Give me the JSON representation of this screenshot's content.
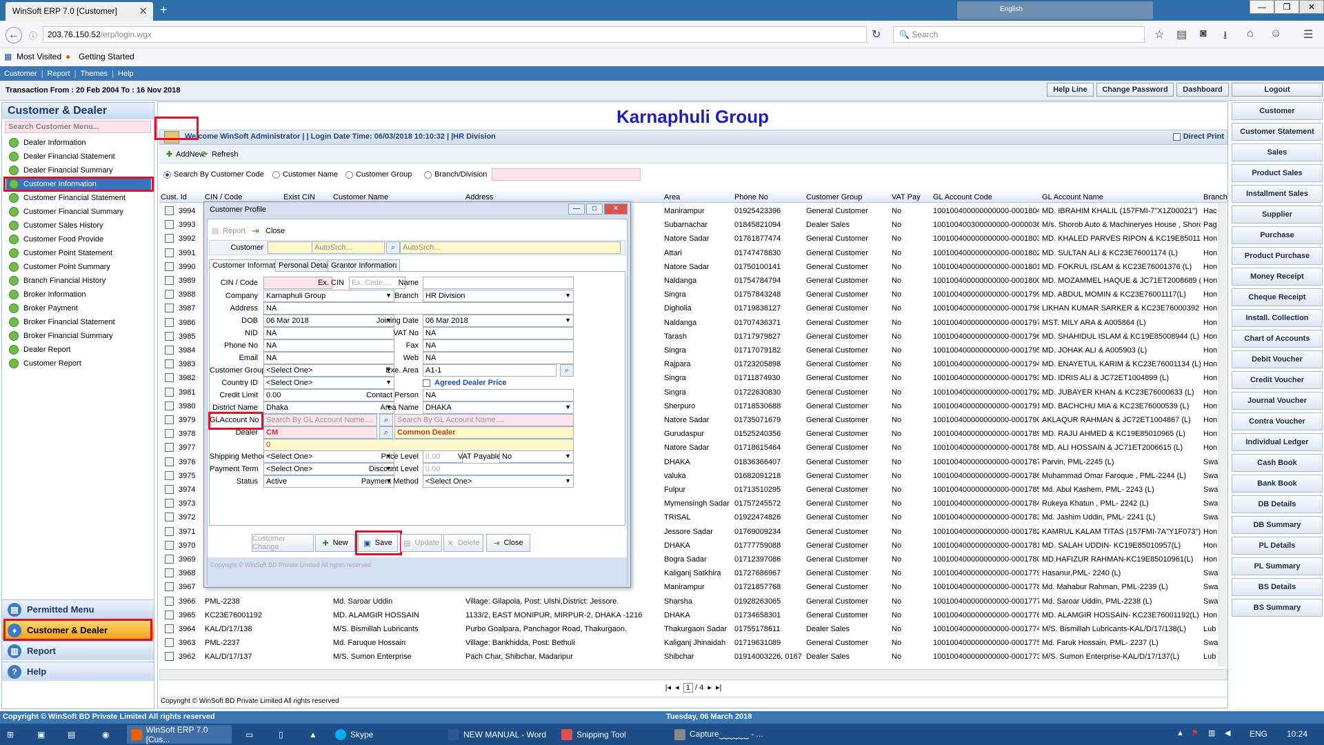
{
  "browser": {
    "tab_title": "WinSoft ERP 7.0 [Customer]",
    "url_host": "203.76.150.52",
    "url_path": "/erp/login.wgx",
    "search_placeholder": "Search",
    "bookmarks": [
      "Most Visited",
      "Getting Started"
    ],
    "lang": "English"
  },
  "app_menu": [
    "Customer",
    "Report",
    "Themes",
    "Help"
  ],
  "transaction": "Transaction From : 20 Feb 2004 To : 16 Nov 2018",
  "top_buttons": [
    "Help Line",
    "Change Password",
    "Dashboard",
    "Logout"
  ],
  "left": {
    "title": "Customer & Dealer",
    "search_placeholder": "Search Customer Menu...",
    "items": [
      "Dealer Information",
      "Dealer Financial Statement",
      "Dealer Financial Summary",
      "Customer Information",
      "Customer Financial Statement",
      "Customer Financial Summary",
      "Customer Sales History",
      "Customer Food Provide",
      "Customer Point Statement",
      "Customer Point Summary",
      "Branch Financial History",
      "Broker Information",
      "Broker Payment",
      "Broker Financial Statement",
      "Broker Financial Summary",
      "Dealer Report",
      "Customer Report"
    ],
    "sections": [
      "Permitted Menu",
      "Customer & Dealer",
      "Report",
      "Help"
    ]
  },
  "right_buttons": [
    "Customer",
    "Customer Statement",
    "Sales",
    "Product Sales",
    "Installment Sales",
    "Supplier",
    "Purchase",
    "Product Purchase",
    "Money Receipt",
    "Cheque Receipt",
    "Install. Collection",
    "Chart of Accounts",
    "Debit Voucher",
    "Credit Voucher",
    "Journal Voucher",
    "Contra Voucher",
    "Individual Ledger",
    "Cash Book",
    "Bank Book",
    "DB Details",
    "DB Summary",
    "PL Details",
    "PL Summary",
    "BS Details",
    "BS Summary"
  ],
  "main": {
    "title": "Karnaphuli Group",
    "welcome": "Welcome WinSoft Administrator | | Login Date  Time: 06/03/2018 10:10:32 | |HR Division",
    "direct_print": "Direct Print",
    "addnew": "AddNew",
    "refresh": "Refresh",
    "search_opts": [
      "Search By Customer Code",
      "Customer Name",
      "Customer Group",
      "Branch/Division"
    ],
    "columns": [
      "Cust. Id",
      "CIN / Code",
      "Exist CIN",
      "Customer Name",
      "Address",
      "Area",
      "Phone No",
      "Customer Group",
      "VAT Pay",
      "GL Account Code",
      "GL Account Name",
      "Branch N"
    ],
    "pager": {
      "current": "1",
      "total": "/ 4"
    },
    "copyright": "Copyright © WinSoft BD Private Limited All rights reserved"
  },
  "rows": [
    {
      "id": "3994",
      "cin": "",
      "name": "",
      "addr": "...,P/S: M",
      "area": "Manirampur",
      "phone": "01925423396",
      "group": "General Customer",
      "vat": "No",
      "gl": "100100400000000000-0001804",
      "gln": "MD. IBRAHIM KHALIL (157FMI-7\"X1Z00021\")",
      "br": "Hac"
    },
    {
      "id": "3993",
      "cin": "",
      "name": "",
      "addr": "Nar",
      "area": "Subarnachar",
      "phone": "01845821094",
      "group": "Dealer Sales",
      "vat": "No",
      "gl": "100100400300000000-0000036",
      "gln": "M/s. Shorob Auto & Machineryes House , Shorob",
      "br": "Pag"
    },
    {
      "id": "3992",
      "cin": "",
      "name": "",
      "addr": "",
      "area": "Natore Sadar",
      "phone": "01761877474",
      "group": "General Customer",
      "vat": "No",
      "gl": "100100400000000000-0001803",
      "gln": "MD. KHALED PARVES RIPON & KC19E85011066",
      "br": "Hon"
    },
    {
      "id": "3991",
      "cin": "",
      "name": "",
      "addr": "",
      "area": "Attari",
      "phone": "01747478830",
      "group": "General Customer",
      "vat": "No",
      "gl": "100100400000000000-0001802",
      "gln": "MD. SULTAN ALI & KC23E76001174 (L)",
      "br": "Hon"
    },
    {
      "id": "3990",
      "cin": "",
      "name": "",
      "addr": "",
      "area": "Natore Sadar",
      "phone": "01750100141",
      "group": "General Customer",
      "vat": "No",
      "gl": "100100400000000000-0001801",
      "gln": "MD. FOKRUL ISLAM & KC23E76001376 (L)",
      "br": "Hon"
    },
    {
      "id": "3989",
      "cin": "",
      "name": "",
      "addr": "",
      "area": "Naldanga",
      "phone": "01754784794",
      "group": "General Customer",
      "vat": "No",
      "gl": "100100400000000000-0001800",
      "gln": "MD. MOZAMMEL HAQUE & JC71ET2008689 (L)",
      "br": "Hon"
    },
    {
      "id": "3988",
      "cin": "",
      "name": "",
      "addr": "",
      "area": "Singra",
      "phone": "01757843248",
      "group": "General Customer",
      "vat": "No",
      "gl": "100100400000000000-0001799",
      "gln": "MD. ABDUL MOMIN & KC23E76001117(L)",
      "br": "Hon"
    },
    {
      "id": "3987",
      "cin": "",
      "name": "",
      "addr": "",
      "area": "Digholia",
      "phone": "01719838127",
      "group": "General Customer",
      "vat": "No",
      "gl": "100100400000000000-0001798",
      "gln": "LIKHAN KUMAR SARKER & KC23E76000392 (L)",
      "br": "Hon"
    },
    {
      "id": "3986",
      "cin": "",
      "name": "",
      "addr": "",
      "area": "Naldanga",
      "phone": "01707436371",
      "group": "General Customer",
      "vat": "No",
      "gl": "100100400000000000-0001797",
      "gln": "MST. MILY ARA & A005864 (L)",
      "br": "Hon"
    },
    {
      "id": "3985",
      "cin": "",
      "name": "",
      "addr": "",
      "area": "Tarash",
      "phone": "01717979827",
      "group": "General Customer",
      "vat": "No",
      "gl": "100100400000000000-0001796",
      "gln": "MD. SHAHIDUL ISLAM & KC19E85008944 (L)",
      "br": "Hon"
    },
    {
      "id": "3984",
      "cin": "",
      "name": "",
      "addr": "",
      "area": "Singra",
      "phone": "01717079182",
      "group": "General Customer",
      "vat": "No",
      "gl": "100100400000000000-0001795",
      "gln": "MD. JOHAK ALI & A005903 (L)",
      "br": "Hon"
    },
    {
      "id": "3983",
      "cin": "",
      "name": "",
      "addr": "",
      "area": "Rajpara",
      "phone": "01723205898",
      "group": "General Customer",
      "vat": "No",
      "gl": "100100400000000000-0001794",
      "gln": "MD. ENAYETUL KARIM & KC23E76001134 (L)",
      "br": "Hon"
    },
    {
      "id": "3982",
      "cin": "",
      "name": "",
      "addr": "",
      "area": "Singra",
      "phone": "01711874930",
      "group": "General Customer",
      "vat": "No",
      "gl": "100100400000000000-0001793",
      "gln": "MD. IDRIS ALI & JC72ET1004899 (L)",
      "br": "Hon"
    },
    {
      "id": "3981",
      "cin": "",
      "name": "",
      "addr": "",
      "area": "Singra",
      "phone": "01722630830",
      "group": "General Customer",
      "vat": "No",
      "gl": "100100400000000000-0001792",
      "gln": "MD. JUBAYER KHAN & KC23E76000633 (L)",
      "br": "Hon"
    },
    {
      "id": "3980",
      "cin": "",
      "name": "",
      "addr": "",
      "area": "Sherpuro",
      "phone": "01718530688",
      "group": "General Customer",
      "vat": "No",
      "gl": "100100400000000000-0001791",
      "gln": "MD. BACHCHU MIA & KC23E76000539 (L)",
      "br": "Hon"
    },
    {
      "id": "3979",
      "cin": "",
      "name": "",
      "addr": "",
      "area": "Natore Sadar",
      "phone": "01735071679",
      "group": "General Customer",
      "vat": "No",
      "gl": "100100400000000000-0001790",
      "gln": "AKLAQUR RAHMAN & JC72ET1004867 (L)",
      "br": "Hon"
    },
    {
      "id": "3978",
      "cin": "",
      "name": "",
      "addr": "",
      "area": "Gurudaspur",
      "phone": "01525240356",
      "group": "General Customer",
      "vat": "No",
      "gl": "100100400000000000-0001789",
      "gln": "MD. RAJU AHMED & KC19E85010965 (L)",
      "br": "Hon"
    },
    {
      "id": "3977",
      "cin": "",
      "name": "",
      "addr": "",
      "area": "Natore Sadar",
      "phone": "01718615464",
      "group": "General Customer",
      "vat": "No",
      "gl": "100100400000000000-0001788",
      "gln": "MD. ALI HOSSAIN & JC71ET2006615 (L)",
      "br": "Hon"
    },
    {
      "id": "3976",
      "cin": "",
      "name": "",
      "addr": "rgonj, D",
      "area": "DHAKA",
      "phone": "01836366407",
      "group": "General Customer",
      "vat": "No",
      "gl": "100100400000000000-0001787",
      "gln": "Parvin, PML-2245 (L)",
      "br": "Swa"
    },
    {
      "id": "3975",
      "cin": "",
      "name": "",
      "addr": "valuka",
      "area": "valuka",
      "phone": "01682091218",
      "group": "General Customer",
      "vat": "No",
      "gl": "100100400000000000-0001786",
      "gln": "Muhammad Omar Faroque , PML-2244 (L)",
      "br": "Swa"
    },
    {
      "id": "3974",
      "cin": "",
      "name": "",
      "addr": "ur, Dis",
      "area": "Fulpur",
      "phone": "01713510295",
      "group": "General Customer",
      "vat": "No",
      "gl": "100100400000000000-0001785",
      "gln": "Md. Abul Kashem, PML- 2243 (L)",
      "br": "Swa"
    },
    {
      "id": "3973",
      "cin": "",
      "name": "",
      "addr": "ation: M",
      "area": "Mymensingh Sadar",
      "phone": "01757245572",
      "group": "General Customer",
      "vat": "No",
      "gl": "100100400000000000-0001784",
      "gln": "Rukeya Khatun , PML- 2242 (L)",
      "br": "Swa"
    },
    {
      "id": "3972",
      "cin": "",
      "name": "",
      "addr": "Mymens",
      "area": "TRISAL",
      "phone": "01922474826",
      "group": "General Customer",
      "vat": "No",
      "gl": "100100400000000000-0001783",
      "gln": "Md. Jashim Uddin, PML- 2241 (L)",
      "br": "Swa"
    },
    {
      "id": "3971",
      "cin": "",
      "name": "",
      "addr": "TILLERY",
      "area": "Jessore Sadar",
      "phone": "01769009234",
      "group": "General Customer",
      "vat": "No",
      "gl": "100100400000000000-0001782",
      "gln": "KAMRUL KALAM TITAS (157FMI-7A\"Y1F073\")",
      "br": "Hon"
    },
    {
      "id": "3970",
      "cin": "",
      "name": "",
      "addr": "",
      "area": "DHAKA",
      "phone": "01777759088",
      "group": "General Customer",
      "vat": "No",
      "gl": "100100400000000000-0001781",
      "gln": "MD. SALAH UDDIN- KC19E85010957(L)",
      "br": "Hon"
    },
    {
      "id": "3969",
      "cin": "",
      "name": "",
      "addr": "",
      "area": "Bogra Sadar",
      "phone": "01712397086",
      "group": "General Customer",
      "vat": "No",
      "gl": "100100400000000000-0001780",
      "gln": "MD.HAFIZUR RAHMAN-KC19E85010961(L)",
      "br": "Hon"
    },
    {
      "id": "3968",
      "cin": "",
      "name": "",
      "addr": "",
      "area": "Kaliganj Satkhira",
      "phone": "01727686967",
      "group": "General Customer",
      "vat": "No",
      "gl": "100100400000000000-0001779",
      "gln": "Hasanur,PML- 2240 (L)",
      "br": "Swa"
    },
    {
      "id": "3967",
      "cin": "",
      "name": "",
      "addr": "",
      "area": "Manirampur",
      "phone": "01721857768",
      "group": "General Customer",
      "vat": "No",
      "gl": "100100400000000000-0001778",
      "gln": "Md. Mahabur Rahman, PML-2239 (L)",
      "br": "Swa"
    },
    {
      "id": "3966",
      "cin": "PML-2238",
      "name": "Md. Saroar Uddin",
      "addr": "Village: Gilapola, Post: Ulshi,District: Jessore.",
      "area": "Sharsha",
      "phone": "01928263065",
      "group": "General Customer",
      "vat": "No",
      "gl": "100100400000000000-0001777",
      "gln": "Md. Saroar Uddin, PML-2238 (L)",
      "br": "Swa"
    },
    {
      "id": "3965",
      "cin": "KC23E76001192",
      "name": "MD. ALAMGIR HOSSAIN",
      "addr": "1133/2, EAST MONIPUR, MIRPUR-2, DHAKA -1216",
      "area": "DHAKA",
      "phone": "01734658301",
      "group": "General Customer",
      "vat": "No",
      "gl": "100100400000000000-0001776",
      "gln": "MD. ALAMGIR HOSSAIN- KC23E76001192(L)",
      "br": "Hon"
    },
    {
      "id": "3964",
      "cin": "KAL/D/17/138",
      "name": "M/S. Bismillah Lubricants",
      "addr": "Purbo Goalpara, Panchagor Road, Thakurgaon.",
      "area": "Thakurgaon Sadar",
      "phone": "01755178611",
      "group": "Dealer Sales",
      "vat": "No",
      "gl": "100100400000000000-0001774",
      "gln": "M/S. Bismillah Lubricants-KAL/D/17/138(L)",
      "br": "Lub"
    },
    {
      "id": "3963",
      "cin": "PML-2237",
      "name": "Md. Faruque Hossain",
      "addr": "Village: Bankhidda, Post: Bethuli",
      "area": "Kaliganj Jhinaidah",
      "phone": "01719631089",
      "group": "General Customer",
      "vat": "No",
      "gl": "100100400000000000-0001775",
      "gln": "Md. Faruk Hossain, PML- 2237 (L)",
      "br": "Swa"
    },
    {
      "id": "3962",
      "cin": "KAL/D/17/137",
      "name": "M/S. Sumon Enterprise",
      "addr": "Pach Char, Shibchar, Madaripur",
      "area": "Shibchar",
      "phone": "01914003226, 0167",
      "group": "Dealer Sales",
      "vat": "No",
      "gl": "100100400000000000-0001773",
      "gln": "M/S. Sumon Enterprise-KAL/D/17/137(L)",
      "br": "Lub"
    }
  ],
  "dialog": {
    "title": "Customer Profile",
    "report": "Report",
    "close": "Close",
    "customer_label": "Customer",
    "autosrch1": "AutoSrch...",
    "autosrch2": "AutoSrch...",
    "tabs": [
      "Customer Information",
      "Personal Details",
      "Grantor Information"
    ],
    "labels": {
      "cin": "CIN / Code",
      "excin": "Ex. CIN",
      "name": "Name",
      "company": "Company",
      "branch": "Branch",
      "address": "Address",
      "dob": "DOB",
      "joining": "Joining Date",
      "nid": "NID",
      "vatno": "VAT No",
      "phone": "Phone No",
      "fax": "Fax",
      "email": "Email",
      "web": "Web",
      "custgroup": "Customer Group",
      "exearea": "Exe. Area",
      "country": "Country ID",
      "credit": "Credit Limit",
      "contact": "Contact Person",
      "district": "District Name",
      "area": "Area Name",
      "glacc": "GLAccount No",
      "dealer": "Dealer",
      "shipping": "Shipping Method",
      "price": "Price Level",
      "vatpay": "VAT Payable",
      "payterm": "Payment Term",
      "discount": "Discount Level",
      "status": "Status",
      "paymethod": "Payment Method"
    },
    "values": {
      "excin_ph": "Ex. Code....",
      "company": "Karnaphuli Group",
      "branch": "HR Division",
      "address": "NA",
      "dob": "06  Mar  2018",
      "joining": "06  Mar  2018",
      "nid": "NA",
      "vatno": "NA",
      "phone": "NA",
      "fax": "NA",
      "email": "NA",
      "web": "NA",
      "custgroup": "<Select One>",
      "exearea": "A1-1",
      "country": "<Select One>",
      "agreed": "Agreed Dealer Price",
      "credit": "0.00",
      "contact": "NA",
      "district": "Dhaka",
      "area": "DHAKA",
      "glacc_ph": "Search By GL Account Name....",
      "glacc2_ph": "Search By GL Account Name....",
      "dealer": "CM",
      "dealer_name": "Common Dealer",
      "dealer_zero": "0",
      "shipping": "<Select One>",
      "price": "0.00",
      "vatpay": "No",
      "payterm": "<Select One>",
      "discount": "0.00",
      "status": "Active",
      "paymethod": "<Select One>"
    },
    "buttons": [
      "Customer Change",
      "New",
      "Save",
      "Update",
      "Delete",
      "Close"
    ],
    "copyright": "Copyright © WinSoft BD Private Limited All rights reserved"
  },
  "footer": {
    "copyright": "Copyright © WinSoft BD Private Limited All rights reserved",
    "date": "Tuesday, 06 March 2018"
  },
  "taskbar": {
    "items": [
      "WinSoft ERP 7.0 [Cus...",
      "Skype",
      "NEW MANUAL - Word",
      "Snipping Tool",
      "Capture⏟⏟⏟⏟⏟⏟ - ..."
    ],
    "lang": "ENG",
    "time": "10:24"
  }
}
